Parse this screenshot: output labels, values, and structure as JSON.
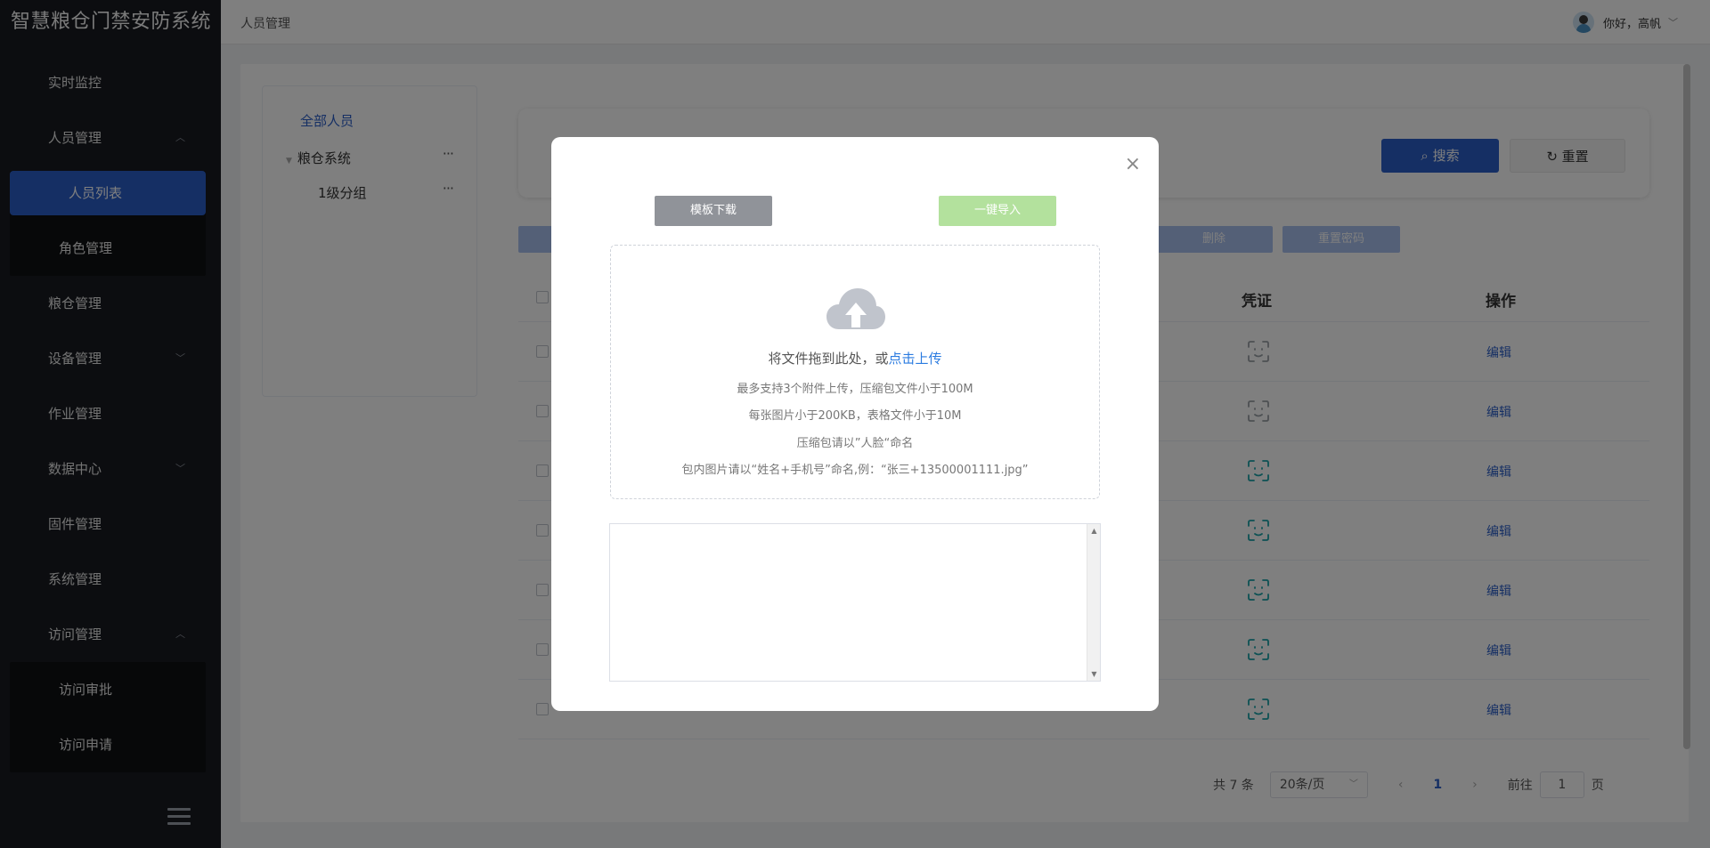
{
  "app": {
    "title": "智慧粮仓门禁安防系统"
  },
  "sidebar": {
    "items": [
      {
        "label": "实时监控"
      },
      {
        "label": "人员管理"
      },
      {
        "label": "人员列表"
      },
      {
        "label": "角色管理"
      },
      {
        "label": "粮仓管理"
      },
      {
        "label": "设备管理"
      },
      {
        "label": "作业管理"
      },
      {
        "label": "数据中心"
      },
      {
        "label": "固件管理"
      },
      {
        "label": "系统管理"
      },
      {
        "label": "访问管理"
      },
      {
        "label": "访问审批"
      },
      {
        "label": "访问申请"
      }
    ]
  },
  "header": {
    "breadcrumb": "人员管理",
    "greeting": "你好，高帆"
  },
  "tree": {
    "all": "全部人员",
    "nodes": [
      {
        "label": "粮仓系统",
        "more": "···"
      },
      {
        "label": "1级分组",
        "more": "···"
      }
    ]
  },
  "search": {
    "search_label": "搜索",
    "reset_label": "重置"
  },
  "actions": {
    "delete_label": "删除",
    "reset_pwd_label": "重置密码"
  },
  "table": {
    "headers": {
      "credential": "凭证",
      "operation": "操作"
    },
    "rows": [
      {
        "edit": "编辑",
        "face_active": false
      },
      {
        "edit": "编辑",
        "face_active": false
      },
      {
        "edit": "编辑",
        "face_active": true
      },
      {
        "edit": "编辑",
        "face_active": true
      },
      {
        "edit": "编辑",
        "face_active": true
      },
      {
        "edit": "编辑",
        "face_active": true
      },
      {
        "edit": "编辑",
        "face_active": true
      }
    ]
  },
  "pager": {
    "total": "共 7 条",
    "page_size": "20条/页",
    "current_page": "1",
    "goto_label": "前往",
    "goto_value": "1",
    "page_unit": "页"
  },
  "dialog": {
    "template_download": "模板下载",
    "one_click_import": "一键导入",
    "drop_text": "将文件拖到此处，或",
    "upload_link": "点击上传",
    "tip1": "最多支持3个附件上传，压缩包文件小于100M",
    "tip2": "每张图片小于200KB，表格文件小于10M",
    "tip3": "压缩包请以”人脸“命名",
    "tip4": "包内图片请以“姓名+手机号”命名,例：“张三+13500001111.jpg”",
    "close": "×"
  },
  "colors": {
    "primary": "#2b5fc9",
    "sidebar_bg": "#181b20",
    "import_btn": "#b3e19d",
    "template_btn": "#909399",
    "face_active": "#1aa3a8",
    "face_inactive": "#9aa0a6"
  },
  "icons": {
    "upload": "cloud-upload-icon",
    "close": "close-icon",
    "search": "search-icon",
    "reset": "refresh-icon",
    "face": "face-scan-icon",
    "collapse": "menu-collapse-icon"
  }
}
